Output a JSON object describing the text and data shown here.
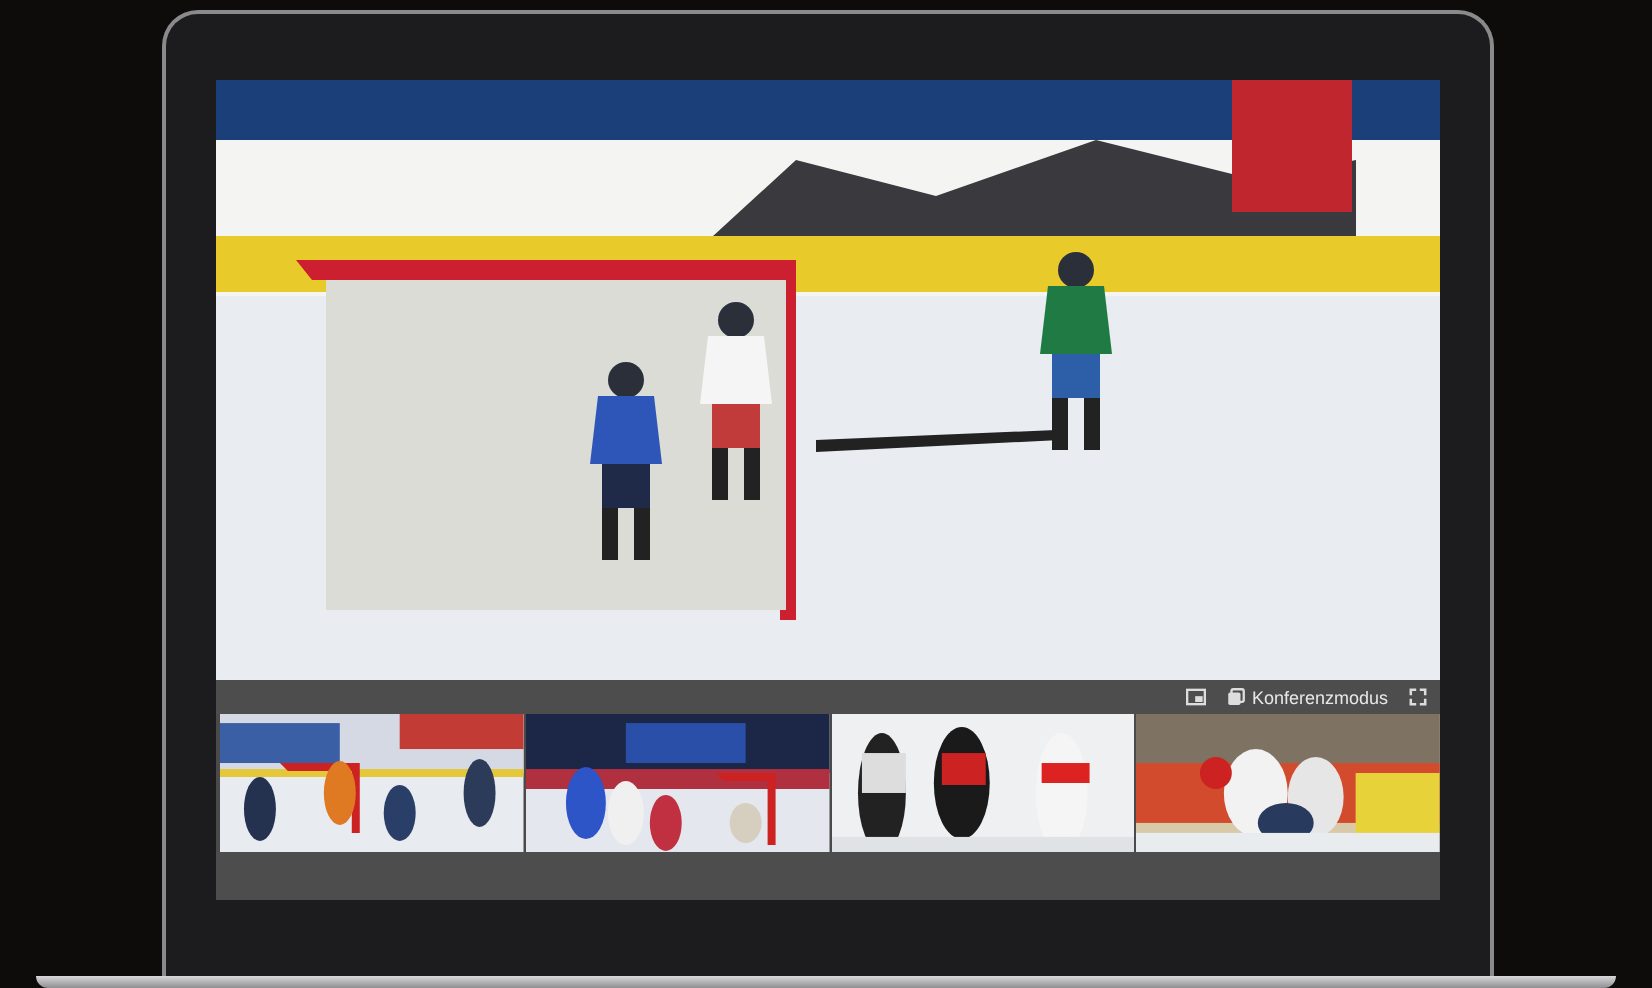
{
  "player": {
    "controls": [
      {
        "kind": "pip"
      },
      {
        "kind": "conference",
        "label": "Konferenzmodus"
      },
      {
        "kind": "fullscreen"
      }
    ]
  }
}
